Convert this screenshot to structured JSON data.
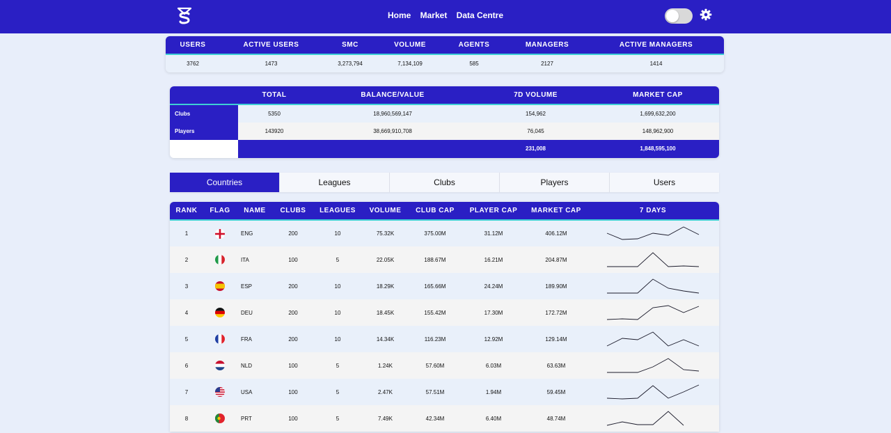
{
  "nav": {
    "home": "Home",
    "market": "Market",
    "data_centre": "Data Centre"
  },
  "icons": {
    "logo": "shield-logo-icon",
    "theme_toggle": "toggle-switch",
    "settings": "gear-icon"
  },
  "colors": {
    "primary": "#2a1fc4",
    "accent_line": "#3ecfd4",
    "background": "#e8eefa"
  },
  "stats": {
    "headers": [
      "USERS",
      "ACTIVE USERS",
      "SMC",
      "VOLUME",
      "AGENTS",
      "MANAGERS",
      "ACTIVE MANAGERS"
    ],
    "values": [
      "3762",
      "1473",
      "3,273,794",
      "7,134,109",
      "585",
      "2127",
      "1414"
    ]
  },
  "totals": {
    "headers": [
      "",
      "TOTAL",
      "BALANCE/VALUE",
      "7D VOLUME",
      "MARKET CAP"
    ],
    "rows": [
      {
        "label": "Clubs",
        "total": "5350",
        "balance": "18,960,569,147",
        "volume": "154,962",
        "market_cap": "1,699,632,200"
      },
      {
        "label": "Players",
        "total": "143920",
        "balance": "38,669,910,708",
        "volume": "76,045",
        "market_cap": "148,962,900"
      }
    ],
    "sum": {
      "volume": "231,008",
      "market_cap": "1,848,595,100"
    }
  },
  "tabs": [
    "Countries",
    "Leagues",
    "Clubs",
    "Players",
    "Users"
  ],
  "active_tab": "Countries",
  "countries": {
    "headers": [
      "RANK",
      "FLAG",
      "NAME",
      "CLUBS",
      "LEAGUES",
      "VOLUME",
      "CLUB CAP",
      "PLAYER CAP",
      "MARKET CAP",
      "7 DAYS"
    ],
    "rows": [
      {
        "rank": "1",
        "flag": "england-flag-icon",
        "name": "ENG",
        "clubs": "200",
        "leagues": "10",
        "volume": "75.32K",
        "club_cap": "375.00M",
        "player_cap": "31.12M",
        "market_cap": "406.12M",
        "trend": [
          0.55,
          0.1,
          0.15,
          0.55,
          0.4,
          1.0,
          0.45
        ]
      },
      {
        "rank": "2",
        "flag": "italy-flag-icon",
        "name": "ITA",
        "clubs": "100",
        "leagues": "5",
        "volume": "22.05K",
        "club_cap": "188.67M",
        "player_cap": "16.21M",
        "market_cap": "204.87M",
        "trend": [
          0.0,
          0.0,
          0.0,
          1.0,
          0.0,
          0.05,
          0.0
        ]
      },
      {
        "rank": "3",
        "flag": "spain-flag-icon",
        "name": "ESP",
        "clubs": "200",
        "leagues": "10",
        "volume": "18.29K",
        "club_cap": "165.66M",
        "player_cap": "24.24M",
        "market_cap": "189.90M",
        "trend": [
          0.0,
          0.0,
          0.0,
          1.0,
          0.35,
          0.15,
          0.0
        ]
      },
      {
        "rank": "4",
        "flag": "germany-flag-icon",
        "name": "DEU",
        "clubs": "200",
        "leagues": "10",
        "volume": "18.45K",
        "club_cap": "155.42M",
        "player_cap": "17.30M",
        "market_cap": "172.72M",
        "trend": [
          0.0,
          0.05,
          0.0,
          0.85,
          1.0,
          0.5,
          0.95
        ]
      },
      {
        "rank": "5",
        "flag": "france-flag-icon",
        "name": "FRA",
        "clubs": "200",
        "leagues": "10",
        "volume": "14.34K",
        "club_cap": "116.23M",
        "player_cap": "12.92M",
        "market_cap": "129.14M",
        "trend": [
          0.0,
          0.55,
          0.45,
          1.0,
          0.0,
          0.45,
          0.0
        ]
      },
      {
        "rank": "6",
        "flag": "netherlands-flag-icon",
        "name": "NLD",
        "clubs": "100",
        "leagues": "5",
        "volume": "1.24K",
        "club_cap": "57.60M",
        "player_cap": "6.03M",
        "market_cap": "63.63M",
        "trend": [
          0.0,
          0.0,
          0.0,
          0.4,
          1.0,
          0.2,
          0.1
        ]
      },
      {
        "rank": "7",
        "flag": "usa-flag-icon",
        "name": "USA",
        "clubs": "100",
        "leagues": "5",
        "volume": "2.47K",
        "club_cap": "57.51M",
        "player_cap": "1.94M",
        "market_cap": "59.45M",
        "trend": [
          0.05,
          0.0,
          0.05,
          0.95,
          0.05,
          0.5,
          1.0
        ]
      },
      {
        "rank": "8",
        "flag": "portugal-flag-icon",
        "name": "PRT",
        "clubs": "100",
        "leagues": "5",
        "volume": "7.49K",
        "club_cap": "42.34M",
        "player_cap": "6.40M",
        "market_cap": "48.74M",
        "trend": [
          0.0,
          0.25,
          0.05,
          0.05,
          1.0,
          0.0,
          null
        ]
      }
    ]
  }
}
